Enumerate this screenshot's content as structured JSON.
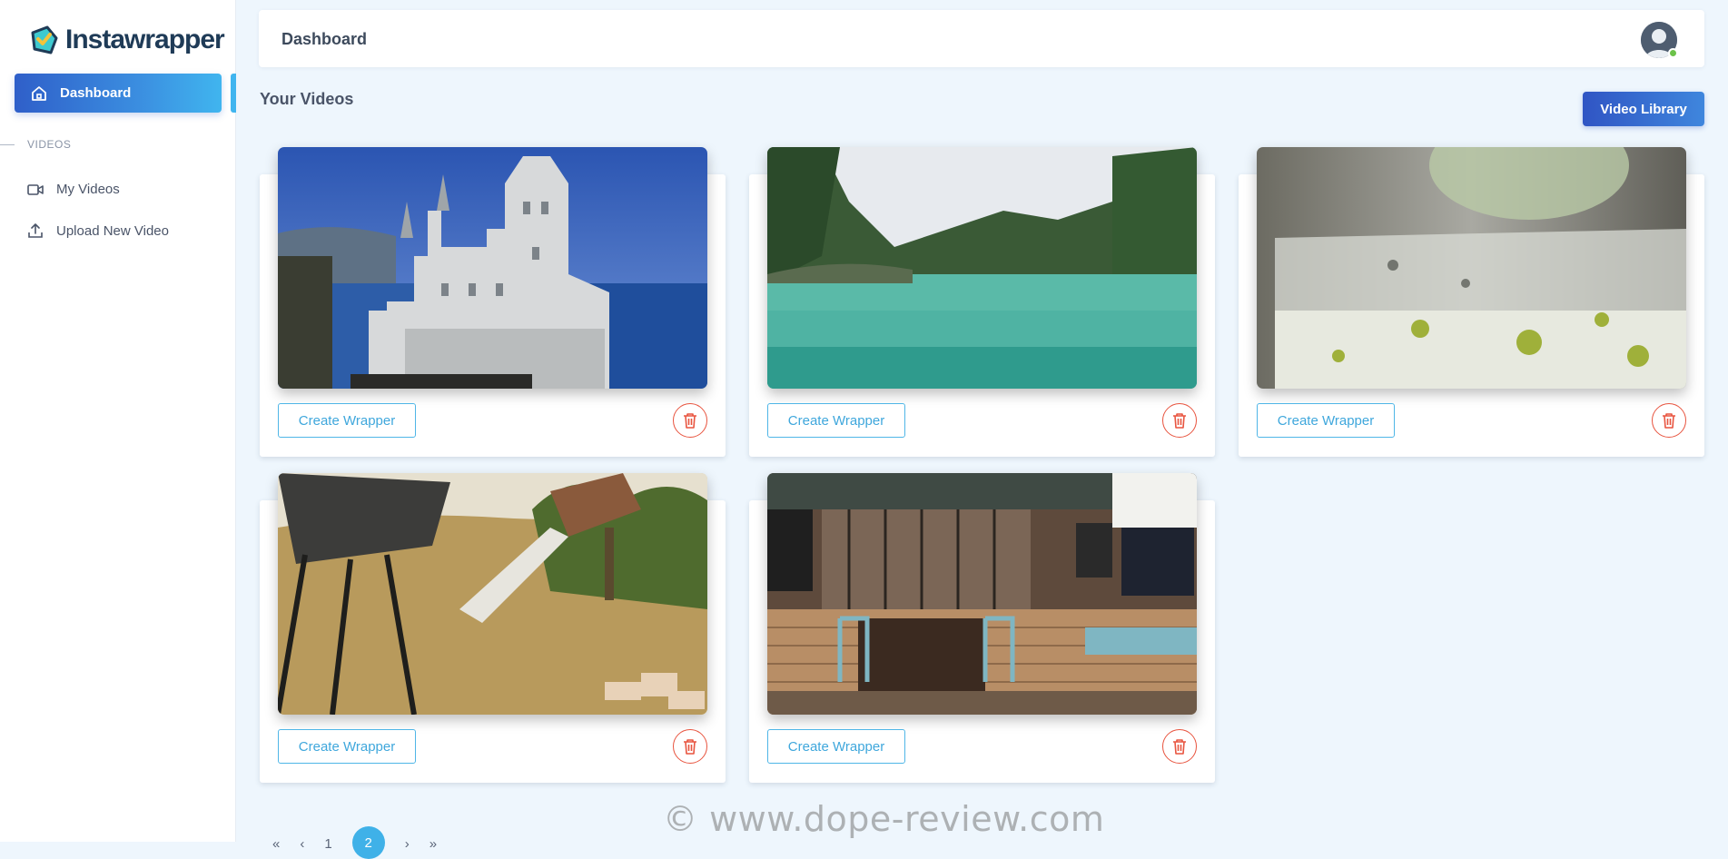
{
  "brand": {
    "name": "Instawrapper"
  },
  "sidebar": {
    "active_item": {
      "label": "Dashboard",
      "icon": "home-icon"
    },
    "section_label": "VIDEOS",
    "items": [
      {
        "label": "My Videos",
        "icon": "video-camera-icon"
      },
      {
        "label": "Upload New Video",
        "icon": "upload-icon"
      }
    ]
  },
  "header": {
    "title": "Dashboard"
  },
  "main": {
    "heading": "Your Videos",
    "library_button": "Video Library",
    "cards": [
      {
        "scene": "castle-by-sea",
        "action_label": "Create Wrapper"
      },
      {
        "scene": "tropical-lagoon",
        "action_label": "Create Wrapper"
      },
      {
        "scene": "blender-glass",
        "action_label": "Create Wrapper"
      },
      {
        "scene": "grill-on-hillside",
        "action_label": "Create Wrapper"
      },
      {
        "scene": "cafe-storefront",
        "action_label": "Create Wrapper"
      }
    ]
  },
  "pagination": {
    "prev_first": "«",
    "prev": "‹",
    "pages": [
      "1",
      "2"
    ],
    "current": "2",
    "next": "›",
    "next_last": "»"
  },
  "watermark": "© www.dope-review.com",
  "colors": {
    "accent": "#3fb1e8",
    "brand_blue": "#3055c4",
    "danger": "#e8543f",
    "page_bg": "#eef6fd"
  }
}
